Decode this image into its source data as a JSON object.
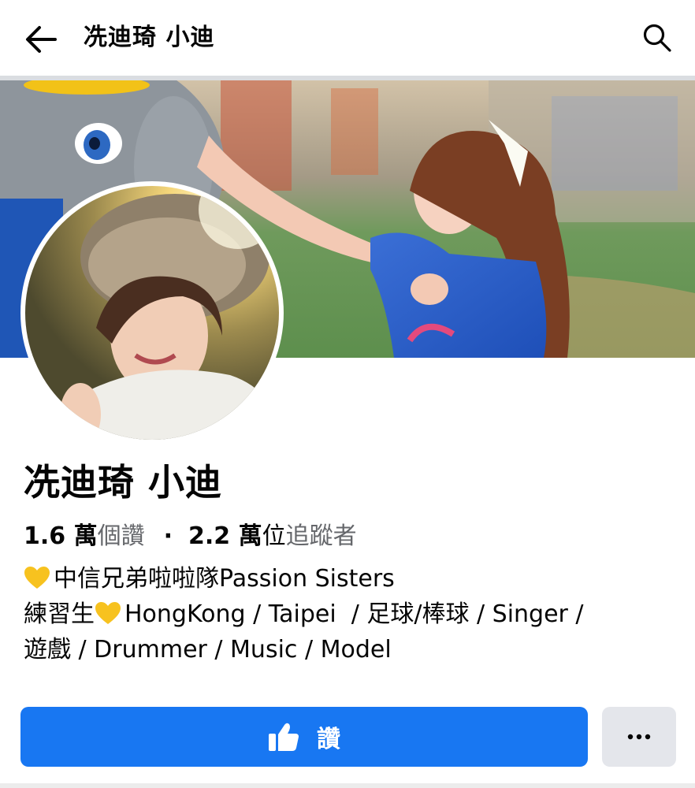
{
  "topbar": {
    "title": "冼迪琦 小迪",
    "back_icon": "arrow-left-icon",
    "search_icon": "search-icon"
  },
  "cover": {
    "description_icon": "cover-photo"
  },
  "profile": {
    "name": "冼迪琦 小迪",
    "likes_count": "1.6 萬",
    "likes_label": "個讚",
    "separator": "·",
    "followers_count": "2.2 萬",
    "followers_label_prefix": "位",
    "followers_label": "追蹤者"
  },
  "bio": {
    "line1": "中信兄弟啦啦隊Passion Sisters",
    "line2_prefix": "練習生",
    "line2_rest": "HongKong / Taipei  / 足球/棒球 / Singer /",
    "line3": "遊戲 / Drummer / Music / Model"
  },
  "actions": {
    "like_label": "讚",
    "like_icon": "thumbs-up-icon",
    "more_icon": "more-dots-icon"
  },
  "colors": {
    "primary": "#1877f2",
    "secondary_button": "#e4e6eb",
    "muted_text": "#65676b",
    "heart": "#f7c21f"
  }
}
